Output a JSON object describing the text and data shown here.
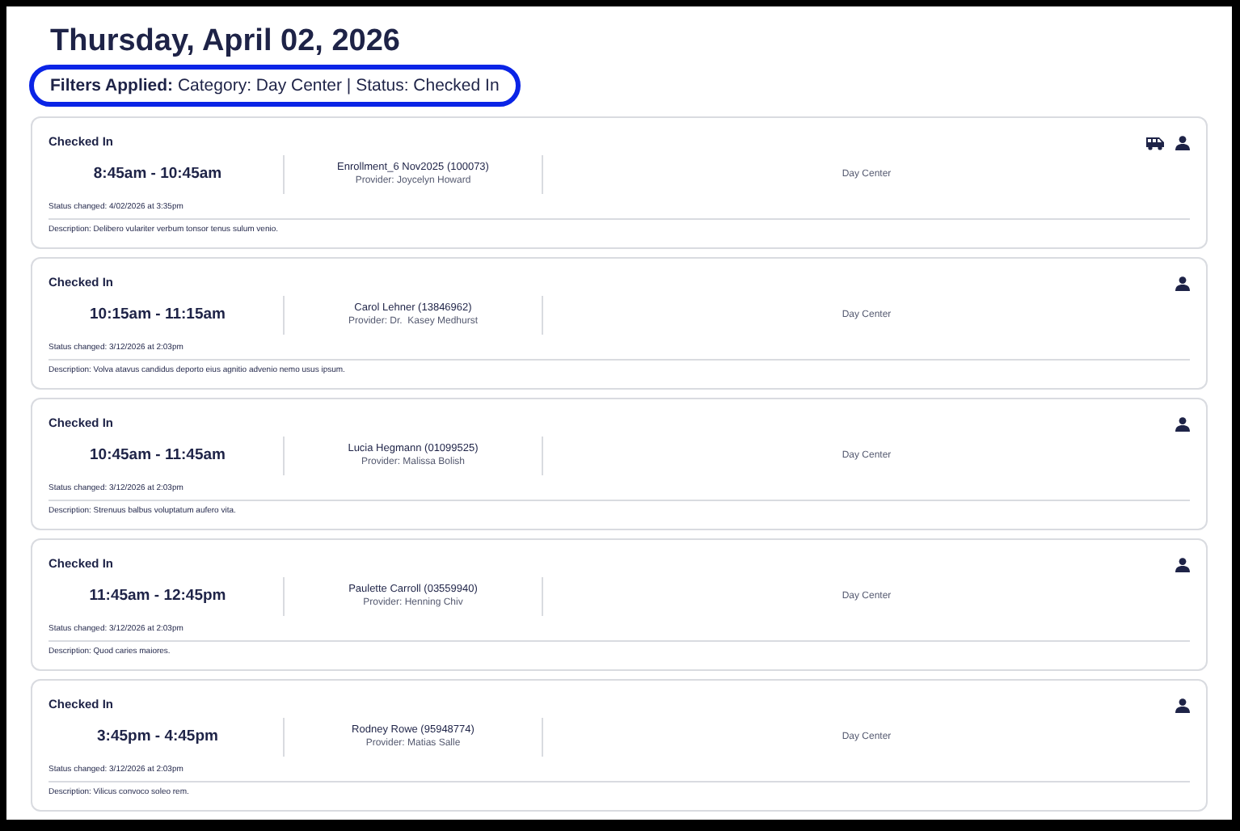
{
  "heading": "Thursday, April 02, 2026",
  "filters": {
    "label": "Filters Applied:",
    "text": "Category: Day Center | Status: Checked In"
  },
  "appointments": [
    {
      "status": "Checked In",
      "time": "8:45am - 10:45am",
      "client": "Enrollment_6 Nov2025 (100073)",
      "provider": "Provider: Joycelyn Howard",
      "location": "Day Center",
      "status_changed": "Status changed: 4/02/2026 at 3:35pm",
      "description": "Description: Delibero vulariter verbum tonsor tenus sulum venio.",
      "icons": [
        {
          "kind": "van"
        },
        {
          "kind": "person"
        }
      ]
    },
    {
      "status": "Checked In",
      "time": "10:15am - 11:15am",
      "client": "Carol Lehner (13846962)",
      "provider": "Provider: Dr.  Kasey Medhurst",
      "location": "Day Center",
      "status_changed": "Status changed: 3/12/2026 at 2:03pm",
      "description": "Description: Volva atavus candidus deporto eius agnitio advenio nemo usus ipsum.",
      "icons": [
        {
          "kind": "person"
        }
      ]
    },
    {
      "status": "Checked In",
      "time": "10:45am - 11:45am",
      "client": "Lucia Hegmann (01099525)",
      "provider": "Provider: Malissa Bolish",
      "location": "Day Center",
      "status_changed": "Status changed: 3/12/2026 at 2:03pm",
      "description": "Description: Strenuus balbus voluptatum aufero vita.",
      "icons": [
        {
          "kind": "person"
        }
      ]
    },
    {
      "status": "Checked In",
      "time": "11:45am - 12:45pm",
      "client": "Paulette Carroll (03559940)",
      "provider": "Provider: Henning Chiv",
      "location": "Day Center",
      "status_changed": "Status changed: 3/12/2026 at 2:03pm",
      "description": "Description: Quod caries maiores.",
      "icons": [
        {
          "kind": "person"
        }
      ]
    },
    {
      "status": "Checked In",
      "time": "3:45pm - 4:45pm",
      "client": "Rodney Rowe (95948774)",
      "provider": "Provider: Matias Salle",
      "location": "Day Center",
      "status_changed": "Status changed: 3/12/2026 at 2:03pm",
      "description": "Description: Vilicus convoco soleo rem.",
      "icons": [
        {
          "kind": "person"
        }
      ]
    }
  ]
}
